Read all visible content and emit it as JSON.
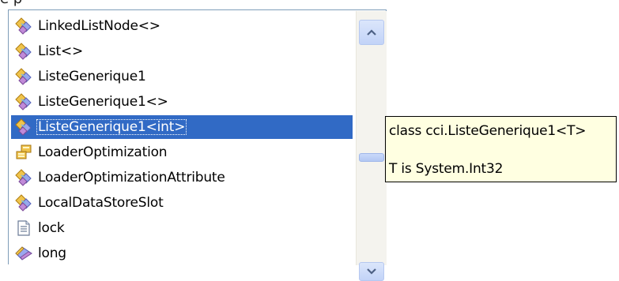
{
  "top_fragment": "e p",
  "list": {
    "items": [
      {
        "label": "LinkedListNode<>",
        "icon": "class-icon",
        "selected": false
      },
      {
        "label": "List<>",
        "icon": "class-icon",
        "selected": false
      },
      {
        "label": "ListeGenerique1",
        "icon": "class-icon",
        "selected": false
      },
      {
        "label": "ListeGenerique1<>",
        "icon": "class-icon",
        "selected": false
      },
      {
        "label": "ListeGenerique1<int>",
        "icon": "class-icon",
        "selected": true
      },
      {
        "label": "LoaderOptimization",
        "icon": "enum-icon",
        "selected": false
      },
      {
        "label": "LoaderOptimizationAttribute",
        "icon": "class-icon",
        "selected": false
      },
      {
        "label": "LocalDataStoreSlot",
        "icon": "class-icon",
        "selected": false
      },
      {
        "label": "lock",
        "icon": "keyword-snippet-icon",
        "selected": false
      },
      {
        "label": "long",
        "icon": "struct-icon",
        "selected": false
      }
    ]
  },
  "tooltip": {
    "line1": "class cci.ListeGenerique1<T>",
    "line2": "T is System.Int32"
  },
  "colors": {
    "selection": "#316ac5",
    "tooltip_bg": "#ffffe1",
    "border": "#7f9db9"
  }
}
